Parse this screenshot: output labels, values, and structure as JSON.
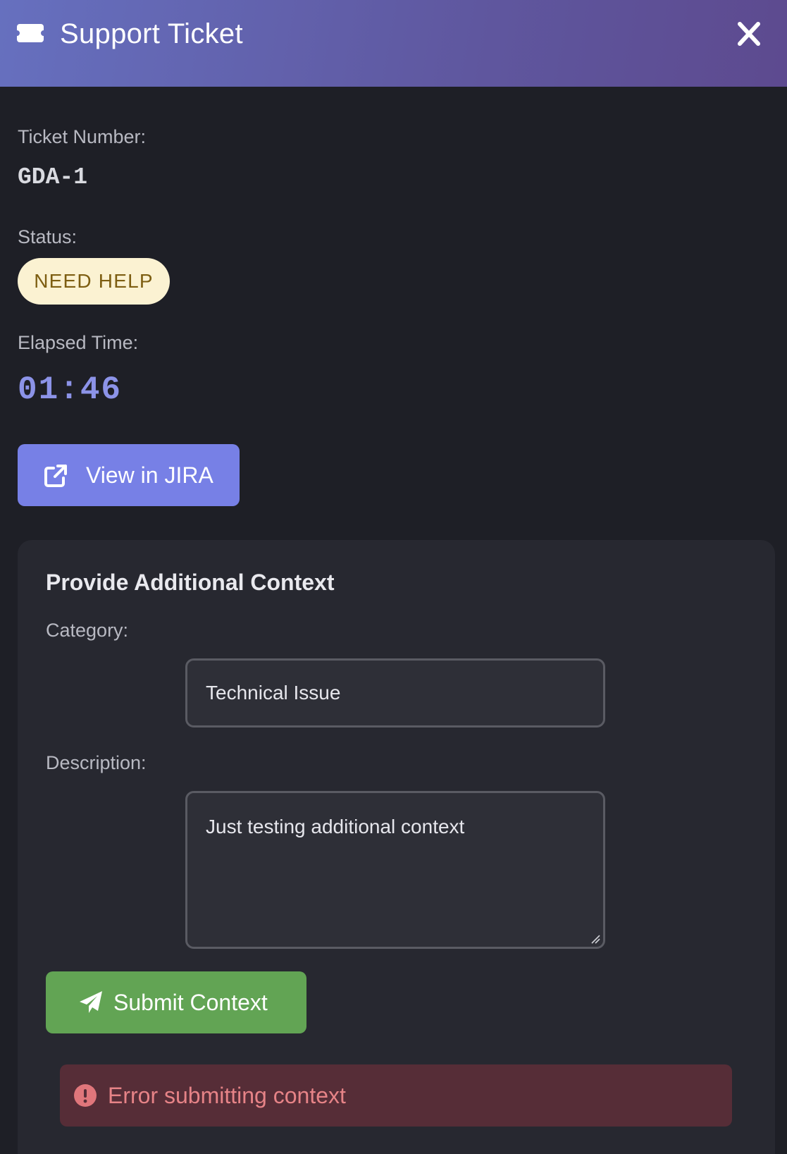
{
  "header": {
    "title": "Support Ticket",
    "icon": "ticket-icon",
    "close_icon": "close-icon"
  },
  "ticket": {
    "number_label": "Ticket Number:",
    "number": "GDA-1",
    "status_label": "Status:",
    "status": "NEED HELP",
    "elapsed_label": "Elapsed Time:",
    "elapsed": "01:46"
  },
  "jira_button": {
    "label": "View in JIRA",
    "icon": "external-link-icon"
  },
  "context_form": {
    "title": "Provide Additional Context",
    "category_label": "Category:",
    "category_value": "Technical Issue",
    "description_label": "Description:",
    "description_value": "Just testing additional context",
    "submit_label": "Submit Context",
    "submit_icon": "paper-plane-icon"
  },
  "error": {
    "icon": "exclamation-circle-icon",
    "message": "Error submitting context"
  },
  "colors": {
    "header_gradient_start": "#6670bf",
    "header_gradient_end": "#5d4a8f",
    "background": "#1e1f26",
    "accent": "#7780e6",
    "success": "#62a454",
    "status_bg": "#fbf2d2",
    "status_text": "#7d5e12",
    "error_bg": "#562d37",
    "error_text": "#e68387"
  }
}
